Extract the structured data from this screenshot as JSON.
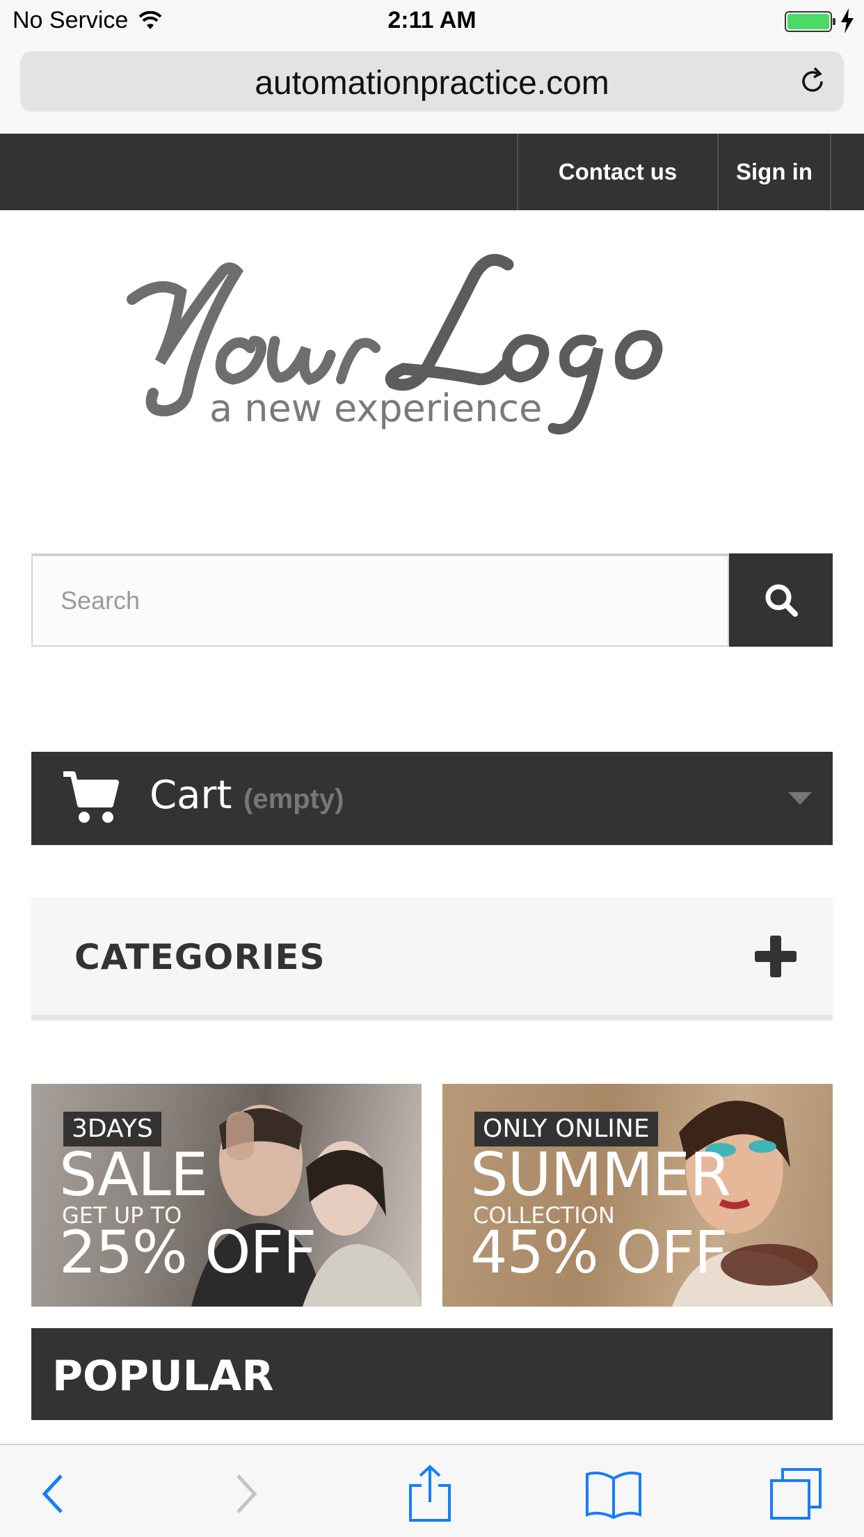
{
  "status_bar": {
    "carrier": "No Service",
    "time": "2:11 AM",
    "battery_percent": 100,
    "battery_color": "#4cd964",
    "icons": [
      "wifi-icon",
      "battery-icon",
      "charging-bolt-icon"
    ]
  },
  "browser": {
    "url": "automationpractice.com",
    "reload_icon": "reload-icon"
  },
  "top_nav": {
    "contact_label": "Contact us",
    "signin_label": "Sign in"
  },
  "logo": {
    "script_text": "YourLogo",
    "tagline": "a new experience"
  },
  "search": {
    "placeholder": "Search",
    "button_icon": "search-icon"
  },
  "cart": {
    "label": "Cart",
    "status": "(empty)",
    "icon": "cart-icon"
  },
  "categories": {
    "title": "CATEGORIES",
    "toggle_icon": "plus-icon"
  },
  "banners": [
    {
      "tag": "3DAYS",
      "headline": "SALE",
      "subline": "GET UP TO",
      "offer": "25% OFF"
    },
    {
      "tag": "ONLY ONLINE",
      "headline": "SUMMER",
      "subline": "COLLECTION",
      "offer": "45% OFF"
    }
  ],
  "popular": {
    "title": "POPULAR"
  },
  "toolbar": {
    "icons": [
      "back-icon",
      "forward-icon",
      "share-icon",
      "bookmarks-icon",
      "tabs-icon"
    ]
  },
  "colors": {
    "dark": "#333333",
    "ios_blue": "#157efb"
  }
}
